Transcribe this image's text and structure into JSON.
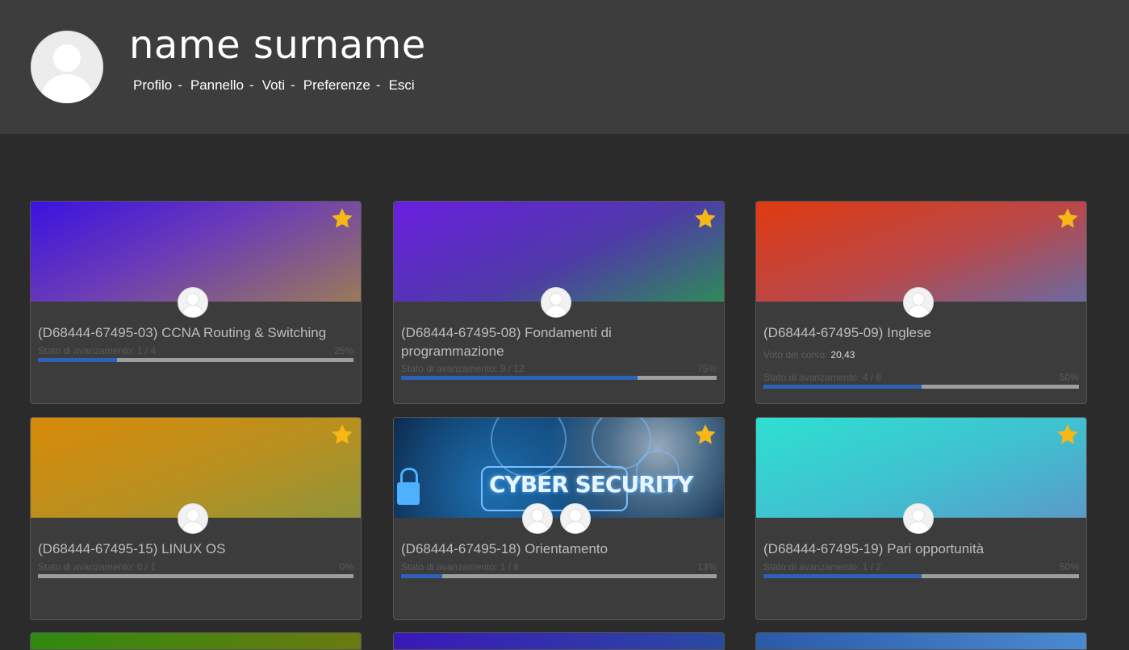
{
  "user": {
    "name": "name surname"
  },
  "nav": {
    "items": [
      "Profilo",
      "Pannello",
      "Voti",
      "Preferenze",
      "Esci"
    ],
    "separator": "-"
  },
  "icons": {
    "favorite": "star-icon",
    "user_avatar": "user-avatar-icon",
    "teacher_avatar": "teacher-avatar-icon"
  },
  "colors": {
    "header_bg": "#3d3d3d",
    "page_bg": "#2b2b2b",
    "card_bg": "#3c3c3c",
    "progress_fill": "#2d62b8",
    "progress_track": "#9e9e9e",
    "star": "#f6b817"
  },
  "courses": [
    {
      "title": "(D68444-67495-03) CCNA Routing & Switching",
      "progress_label": "Stato di avanzamento: 1 / 4",
      "progress_pct": "25%",
      "progress": 0.25,
      "favorite": true
    },
    {
      "title": "(D68444-67495-08) Fondamenti di programmazione",
      "progress_label": "Stato di avanzamento: 9 / 12",
      "progress_pct": "75%",
      "progress": 0.75,
      "favorite": true
    },
    {
      "title": "(D68444-67495-09) Inglese",
      "grade_label": "Voto del corso:",
      "grade_value": "20,43",
      "progress_label": "Stato di avanzamento: 4 / 8",
      "progress_pct": "50%",
      "progress": 0.5,
      "favorite": true
    },
    {
      "title": "(D68444-67495-15) LINUX OS",
      "progress_label": "Stato di avanzamento: 0 / 1",
      "progress_pct": "0%",
      "progress": 0,
      "favorite": true
    },
    {
      "title": "(D68444-67495-18) Orientamento",
      "banner_text": "CYBER SECURITY",
      "progress_label": "Stato di avanzamento: 1 / 8",
      "progress_pct": "13%",
      "progress": 0.13,
      "favorite": true
    },
    {
      "title": "(D68444-67495-19) Pari opportunità",
      "progress_label": "Stato di avanzamento: 1 / 2",
      "progress_pct": "50%",
      "progress": 0.5,
      "favorite": true
    }
  ]
}
